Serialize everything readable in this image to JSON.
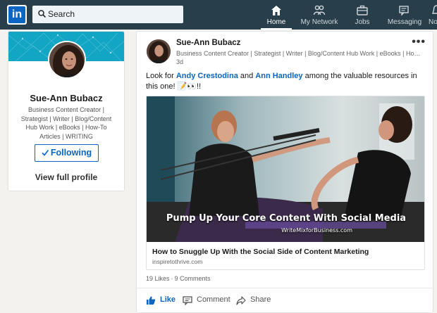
{
  "nav": {
    "logo_text": "in",
    "search_label": "Search",
    "items": [
      {
        "label": "Home",
        "icon": "home-icon",
        "active": true
      },
      {
        "label": "My Network",
        "icon": "network-icon",
        "active": false
      },
      {
        "label": "Jobs",
        "icon": "jobs-icon",
        "active": false
      },
      {
        "label": "Messaging",
        "icon": "messaging-icon",
        "active": false
      },
      {
        "label": "No",
        "icon": "notifications-icon",
        "active": false
      }
    ]
  },
  "profile": {
    "name": "Sue-Ann Bubacz",
    "headline": "Business Content Creator | Strategist | Writer | Blog/Content Hub Work | eBooks | How-To Articles | WRITING",
    "follow_label": "Following",
    "view_profile_label": "View full profile"
  },
  "post": {
    "author": "Sue-Ann Bubacz",
    "headline": "Business Content Creator | Strategist | Writer | Blog/Content Hub Work | eBooks | How-To Articles | WRITING",
    "time": "3d",
    "more": "•••",
    "text_before": "Look for ",
    "mention_1": "Andy Crestodina",
    "text_and": " and ",
    "mention_2": "Ann Handley",
    "text_after": " among the valuable resources in this one! 📝👀!!",
    "image_caption": "Pump Up Your Core Content With Social Media",
    "image_site": "WriteMixforBusiness.com",
    "link_title": "How to Snuggle Up With the Social Side of Content Marketing",
    "link_domain": "inspiretothrive.com",
    "likes": "19 Likes",
    "stats_sep": "·",
    "comments": "9 Comments",
    "actions": {
      "like": "Like",
      "comment": "Comment",
      "share": "Share"
    }
  },
  "colors": {
    "nav_bg": "#283e4a",
    "brand_blue": "#0a66c2",
    "cover": "#12a5c4",
    "page_bg": "#f3f2ef"
  }
}
